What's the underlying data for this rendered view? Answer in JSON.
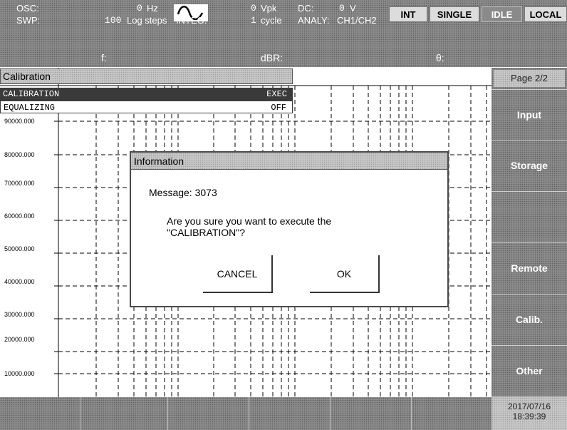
{
  "status": {
    "osc_label": "OSC:",
    "osc_freq": "0",
    "osc_freq_unit": "Hz",
    "osc_level": "0",
    "osc_level_unit": "Vpk",
    "dc_label": "DC:",
    "dc_value": "0",
    "dc_unit": "V",
    "swp_label": "SWP:",
    "swp_steps": "100",
    "swp_mode": "Log steps",
    "integ_label": "INTEG:",
    "integ_value": "1",
    "integ_unit": "cycle",
    "analy_label": "ANALY:",
    "analy_value": "CH1/CH2",
    "waveform_icon": "sine-wave-icon"
  },
  "mode_buttons": {
    "int": "INT",
    "single": "SINGLE",
    "idle": "IDLE",
    "local": "LOCAL"
  },
  "measurements": {
    "f_label": "f:",
    "dbr_label": "dBR:",
    "theta_label": "θ:"
  },
  "menu": {
    "title": "Calibration",
    "items": [
      {
        "label": "CALIBRATION",
        "value": "EXEC"
      },
      {
        "label": "EQUALIZING",
        "value": "OFF"
      }
    ]
  },
  "graph": {
    "y_labels": [
      "90000.000",
      "80000.000",
      "70000.000",
      "60000.000",
      "50000.000",
      "40000.000",
      "30000.000",
      "20000.000",
      "10000.000"
    ]
  },
  "side_panel": {
    "page": "Page 2/2",
    "softkeys": [
      "Input",
      "Storage",
      "",
      "Remote",
      "Calib.",
      "Other"
    ],
    "date": "2017/07/16",
    "time": "18:39:39"
  },
  "dialog": {
    "title": "Information",
    "message_label": "Message: 3073",
    "question_line1": "Are you sure you want to execute the",
    "question_line2": "\"CALIBRATION\"?",
    "cancel_label": "CANCEL",
    "ok_label": "OK"
  }
}
